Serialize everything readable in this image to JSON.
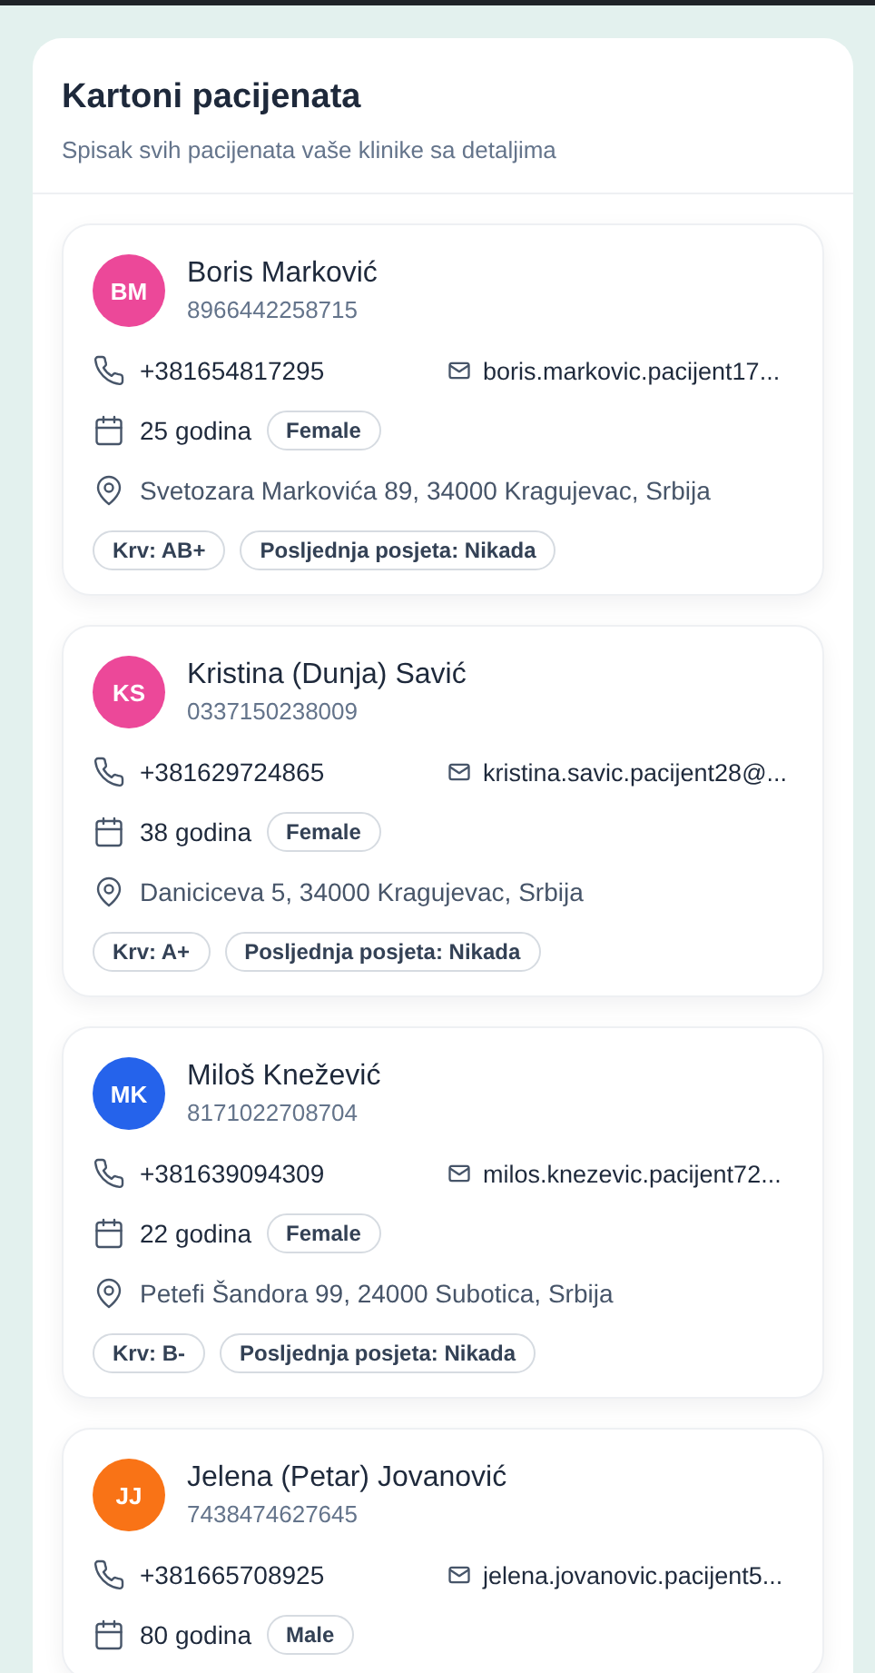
{
  "header": {
    "title": "Kartoni pacijenata",
    "subtitle": "Spisak svih pacijenata vaše klinike sa detaljima"
  },
  "patients": [
    {
      "initials": "BM",
      "color": "#ec4899",
      "name": "Boris Marković",
      "id_number": "8966442258715",
      "phone": "+381654817295",
      "email": "boris.markovic.pacijent17...",
      "age": "25 godina",
      "gender": "Female",
      "address": "Svetozara Markovića 89, 34000 Kragujevac, Srbija",
      "blood": "Krv: AB+",
      "last_visit": "Posljednja posjeta: Nikada"
    },
    {
      "initials": "KS",
      "color": "#ec4899",
      "name": "Kristina (Dunja) Savić",
      "id_number": "0337150238009",
      "phone": "+381629724865",
      "email": "kristina.savic.pacijent28@...",
      "age": "38 godina",
      "gender": "Female",
      "address": "Daniciceva 5, 34000 Kragujevac, Srbija",
      "blood": "Krv: A+",
      "last_visit": "Posljednja posjeta: Nikada"
    },
    {
      "initials": "MK",
      "color": "#2563eb",
      "name": "Miloš Knežević",
      "id_number": "8171022708704",
      "phone": "+381639094309",
      "email": "milos.knezevic.pacijent72...",
      "age": "22 godina",
      "gender": "Female",
      "address": "Petefi Šandora 99, 24000 Subotica, Srbija",
      "blood": "Krv: B-",
      "last_visit": "Posljednja posjeta: Nikada"
    },
    {
      "initials": "JJ",
      "color": "#f97316",
      "name": "Jelena (Petar) Jovanović",
      "id_number": "7438474627645",
      "phone": "+381665708925",
      "email": "jelena.jovanovic.pacijent5...",
      "age": "80 godina",
      "gender": "Male"
    }
  ]
}
